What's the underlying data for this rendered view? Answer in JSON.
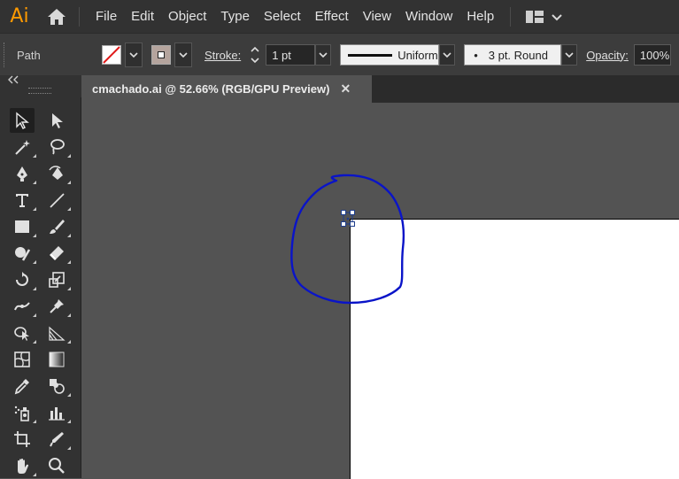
{
  "app": {
    "logo_text": "Ai"
  },
  "menu": [
    "File",
    "Edit",
    "Object",
    "Type",
    "Select",
    "Effect",
    "View",
    "Window",
    "Help"
  ],
  "control_bar": {
    "selection_label": "Path",
    "stroke_label": "Stroke:",
    "stroke_weight": "1 pt",
    "variable_width_profile": "Uniform",
    "brush_definition": "3 pt. Round",
    "brush_bullet": "•",
    "opacity_label": "Opacity:",
    "opacity_value": "100%"
  },
  "document_tab": {
    "title": "cmachado.ai @ 52.66% (RGB/GPU Preview)",
    "close_glyph": "✕"
  },
  "colors": {
    "stroke_path": "#0a14c8",
    "fill_swatch": "#b5a49d",
    "selection_handle": "#1f3e8c"
  },
  "tools": [
    "selection-tool",
    "direct-selection-tool",
    "magic-wand-tool",
    "lasso-tool",
    "pen-tool",
    "curvature-tool",
    "type-tool",
    "line-segment-tool",
    "rectangle-tool",
    "paintbrush-tool",
    "shaper-tool",
    "eraser-tool",
    "rotate-tool",
    "scale-tool",
    "width-tool",
    "puppet-warp-tool",
    "shape-builder-tool",
    "perspective-grid-tool",
    "mesh-tool",
    "gradient-tool",
    "eyedropper-tool",
    "blend-tool",
    "symbol-sprayer-tool",
    "column-graph-tool",
    "artboard-tool",
    "slice-tool",
    "hand-tool",
    "zoom-tool"
  ]
}
